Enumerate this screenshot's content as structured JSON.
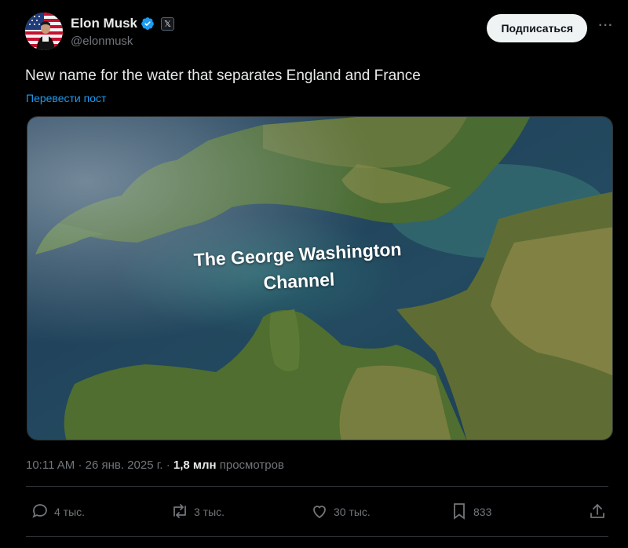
{
  "author": {
    "display_name": "Elon Musk",
    "handle": "@elonmusk",
    "affiliation_badge": "𝕏",
    "verified_color": "#1d9bf0"
  },
  "header": {
    "subscribe_label": "Подписаться",
    "more_label": "···"
  },
  "tweet": {
    "text": "New name for the water that separates England and France",
    "translate_label": "Перевести пост",
    "image_overlay_line1": "The George Washington",
    "image_overlay_line2": "Channel"
  },
  "meta": {
    "time": "10:11 AM",
    "sep1": "·",
    "date": "26 янв. 2025 г.",
    "sep2": "·",
    "views_count": "1,8 млн",
    "views_label": "просмотров"
  },
  "actions": {
    "replies": "4 тыс.",
    "reposts": "3 тыс.",
    "likes": "30 тыс.",
    "bookmarks": "833"
  },
  "icons": [
    "verified-badge-icon",
    "reply-icon",
    "repost-icon",
    "like-icon",
    "bookmark-icon",
    "share-icon"
  ],
  "colors": {
    "background": "#000000",
    "text": "#e7e9ea",
    "secondary": "#71767b",
    "link": "#1d9bf0"
  }
}
